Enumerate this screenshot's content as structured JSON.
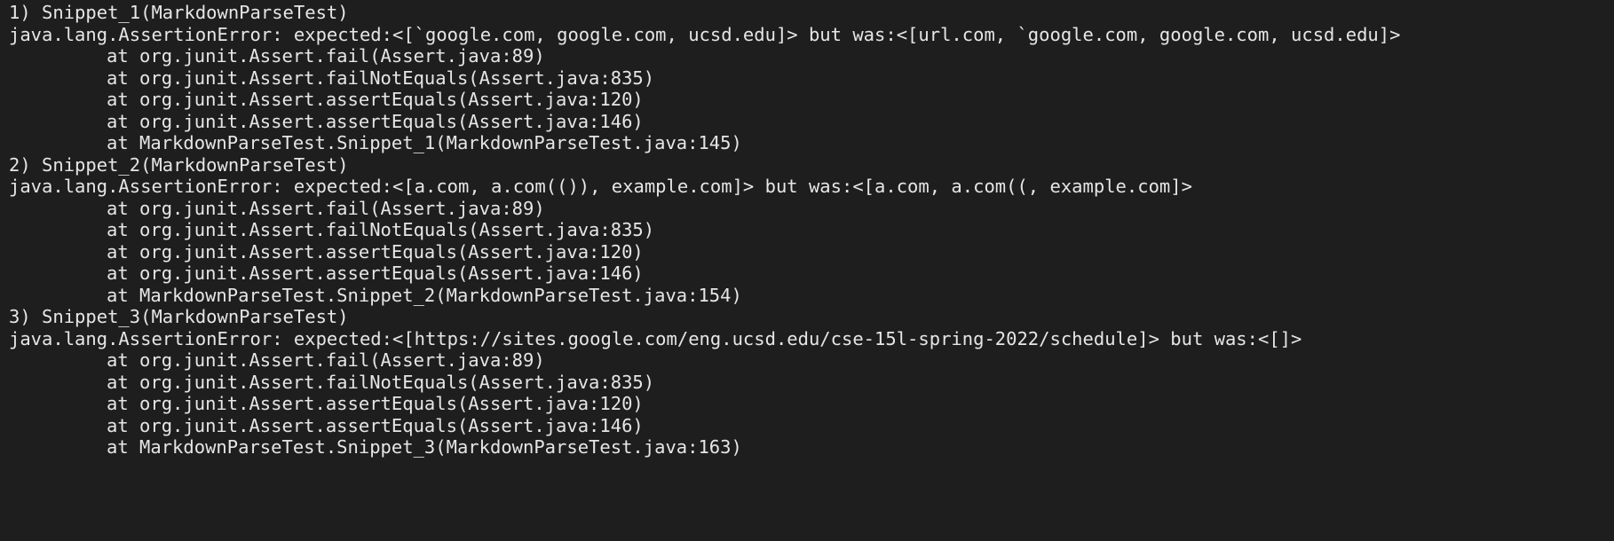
{
  "terminal": {
    "partial_top_line": "─ ─ ─ ─ ─ ─",
    "lines": [
      {
        "text": "1) Snippet_1(MarkdownParseTest)",
        "kind": "header"
      },
      {
        "text": "java.lang.AssertionError: expected:<[`google.com, google.com, ucsd.edu]> but was:<[url.com, `google.com, google.com, ucsd.edu]>",
        "kind": "error"
      },
      {
        "text": "at org.junit.Assert.fail(Assert.java:89)",
        "kind": "frame"
      },
      {
        "text": "at org.junit.Assert.failNotEquals(Assert.java:835)",
        "kind": "frame"
      },
      {
        "text": "at org.junit.Assert.assertEquals(Assert.java:120)",
        "kind": "frame"
      },
      {
        "text": "at org.junit.Assert.assertEquals(Assert.java:146)",
        "kind": "frame"
      },
      {
        "text": "at MarkdownParseTest.Snippet_1(MarkdownParseTest.java:145)",
        "kind": "frame"
      },
      {
        "text": "2) Snippet_2(MarkdownParseTest)",
        "kind": "header"
      },
      {
        "text": "java.lang.AssertionError: expected:<[a.com, a.com(()), example.com]> but was:<[a.com, a.com((, example.com]>",
        "kind": "error"
      },
      {
        "text": "at org.junit.Assert.fail(Assert.java:89)",
        "kind": "frame"
      },
      {
        "text": "at org.junit.Assert.failNotEquals(Assert.java:835)",
        "kind": "frame"
      },
      {
        "text": "at org.junit.Assert.assertEquals(Assert.java:120)",
        "kind": "frame"
      },
      {
        "text": "at org.junit.Assert.assertEquals(Assert.java:146)",
        "kind": "frame"
      },
      {
        "text": "at MarkdownParseTest.Snippet_2(MarkdownParseTest.java:154)",
        "kind": "frame"
      },
      {
        "text": "3) Snippet_3(MarkdownParseTest)",
        "kind": "header"
      },
      {
        "text": "java.lang.AssertionError: expected:<[https://sites.google.com/eng.ucsd.edu/cse-15l-spring-2022/schedule]> but was:<[]>",
        "kind": "error"
      },
      {
        "text": "at org.junit.Assert.fail(Assert.java:89)",
        "kind": "frame"
      },
      {
        "text": "at org.junit.Assert.failNotEquals(Assert.java:835)",
        "kind": "frame"
      },
      {
        "text": "at org.junit.Assert.assertEquals(Assert.java:120)",
        "kind": "frame"
      },
      {
        "text": "at org.junit.Assert.assertEquals(Assert.java:146)",
        "kind": "frame"
      },
      {
        "text": "at MarkdownParseTest.Snippet_3(MarkdownParseTest.java:163)",
        "kind": "frame"
      }
    ]
  },
  "colors": {
    "background": "#1e1e1e",
    "text": "#e6e6e6"
  }
}
